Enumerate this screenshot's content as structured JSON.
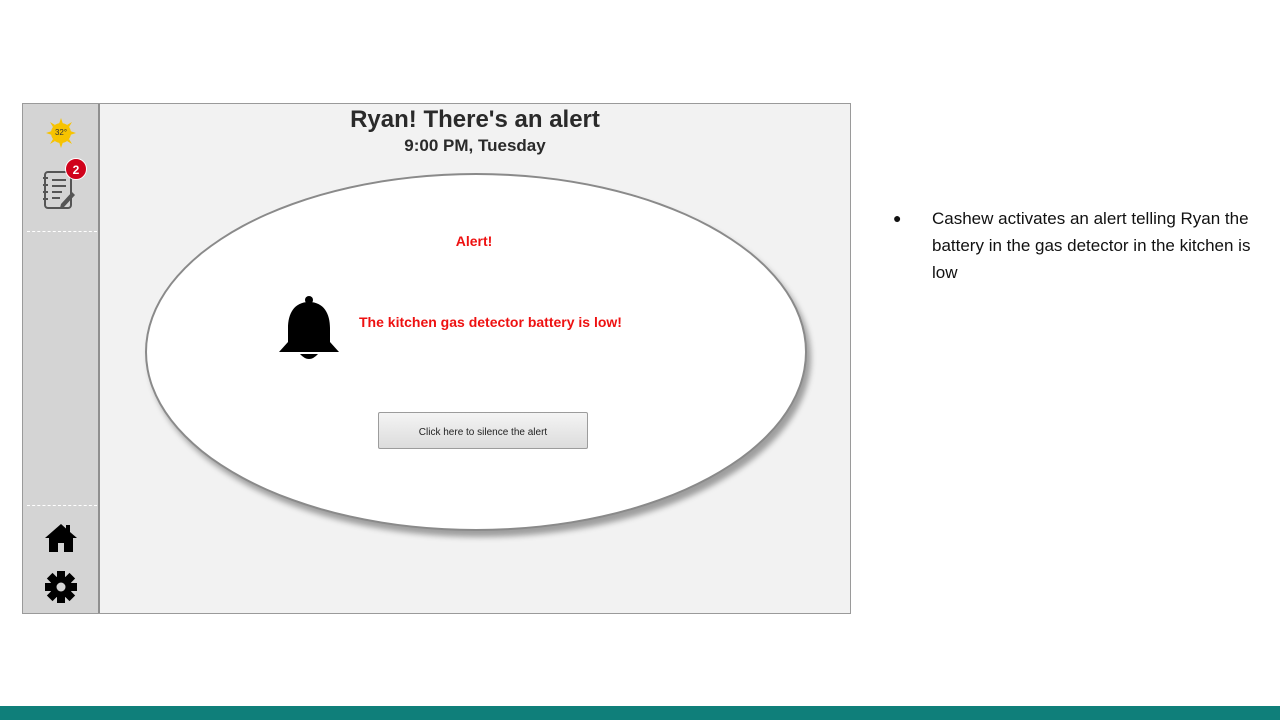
{
  "sidebar": {
    "weather": {
      "temperature": "32°",
      "icon": "sun-icon"
    },
    "notifications": {
      "icon": "notepad-icon",
      "count": "2"
    },
    "nav": [
      {
        "icon": "home-icon"
      },
      {
        "icon": "gear-icon"
      }
    ]
  },
  "header": {
    "title": "Ryan! There's an alert",
    "subtitle": "9:00 PM, Tuesday"
  },
  "alert": {
    "title": "Alert!",
    "icon": "bell-icon",
    "message": "The kitchen gas detector battery is low!",
    "button_label": "Click here to silence the alert"
  },
  "notes": {
    "items": [
      "Cashew activates an alert telling Ryan the battery in the gas detector in the kitchen is low"
    ]
  },
  "colors": {
    "alert_red": "#ee1111",
    "footer_teal": "#0f7f7a",
    "sidebar_gray": "#d4d4d4",
    "badge_red": "#d0021b"
  }
}
